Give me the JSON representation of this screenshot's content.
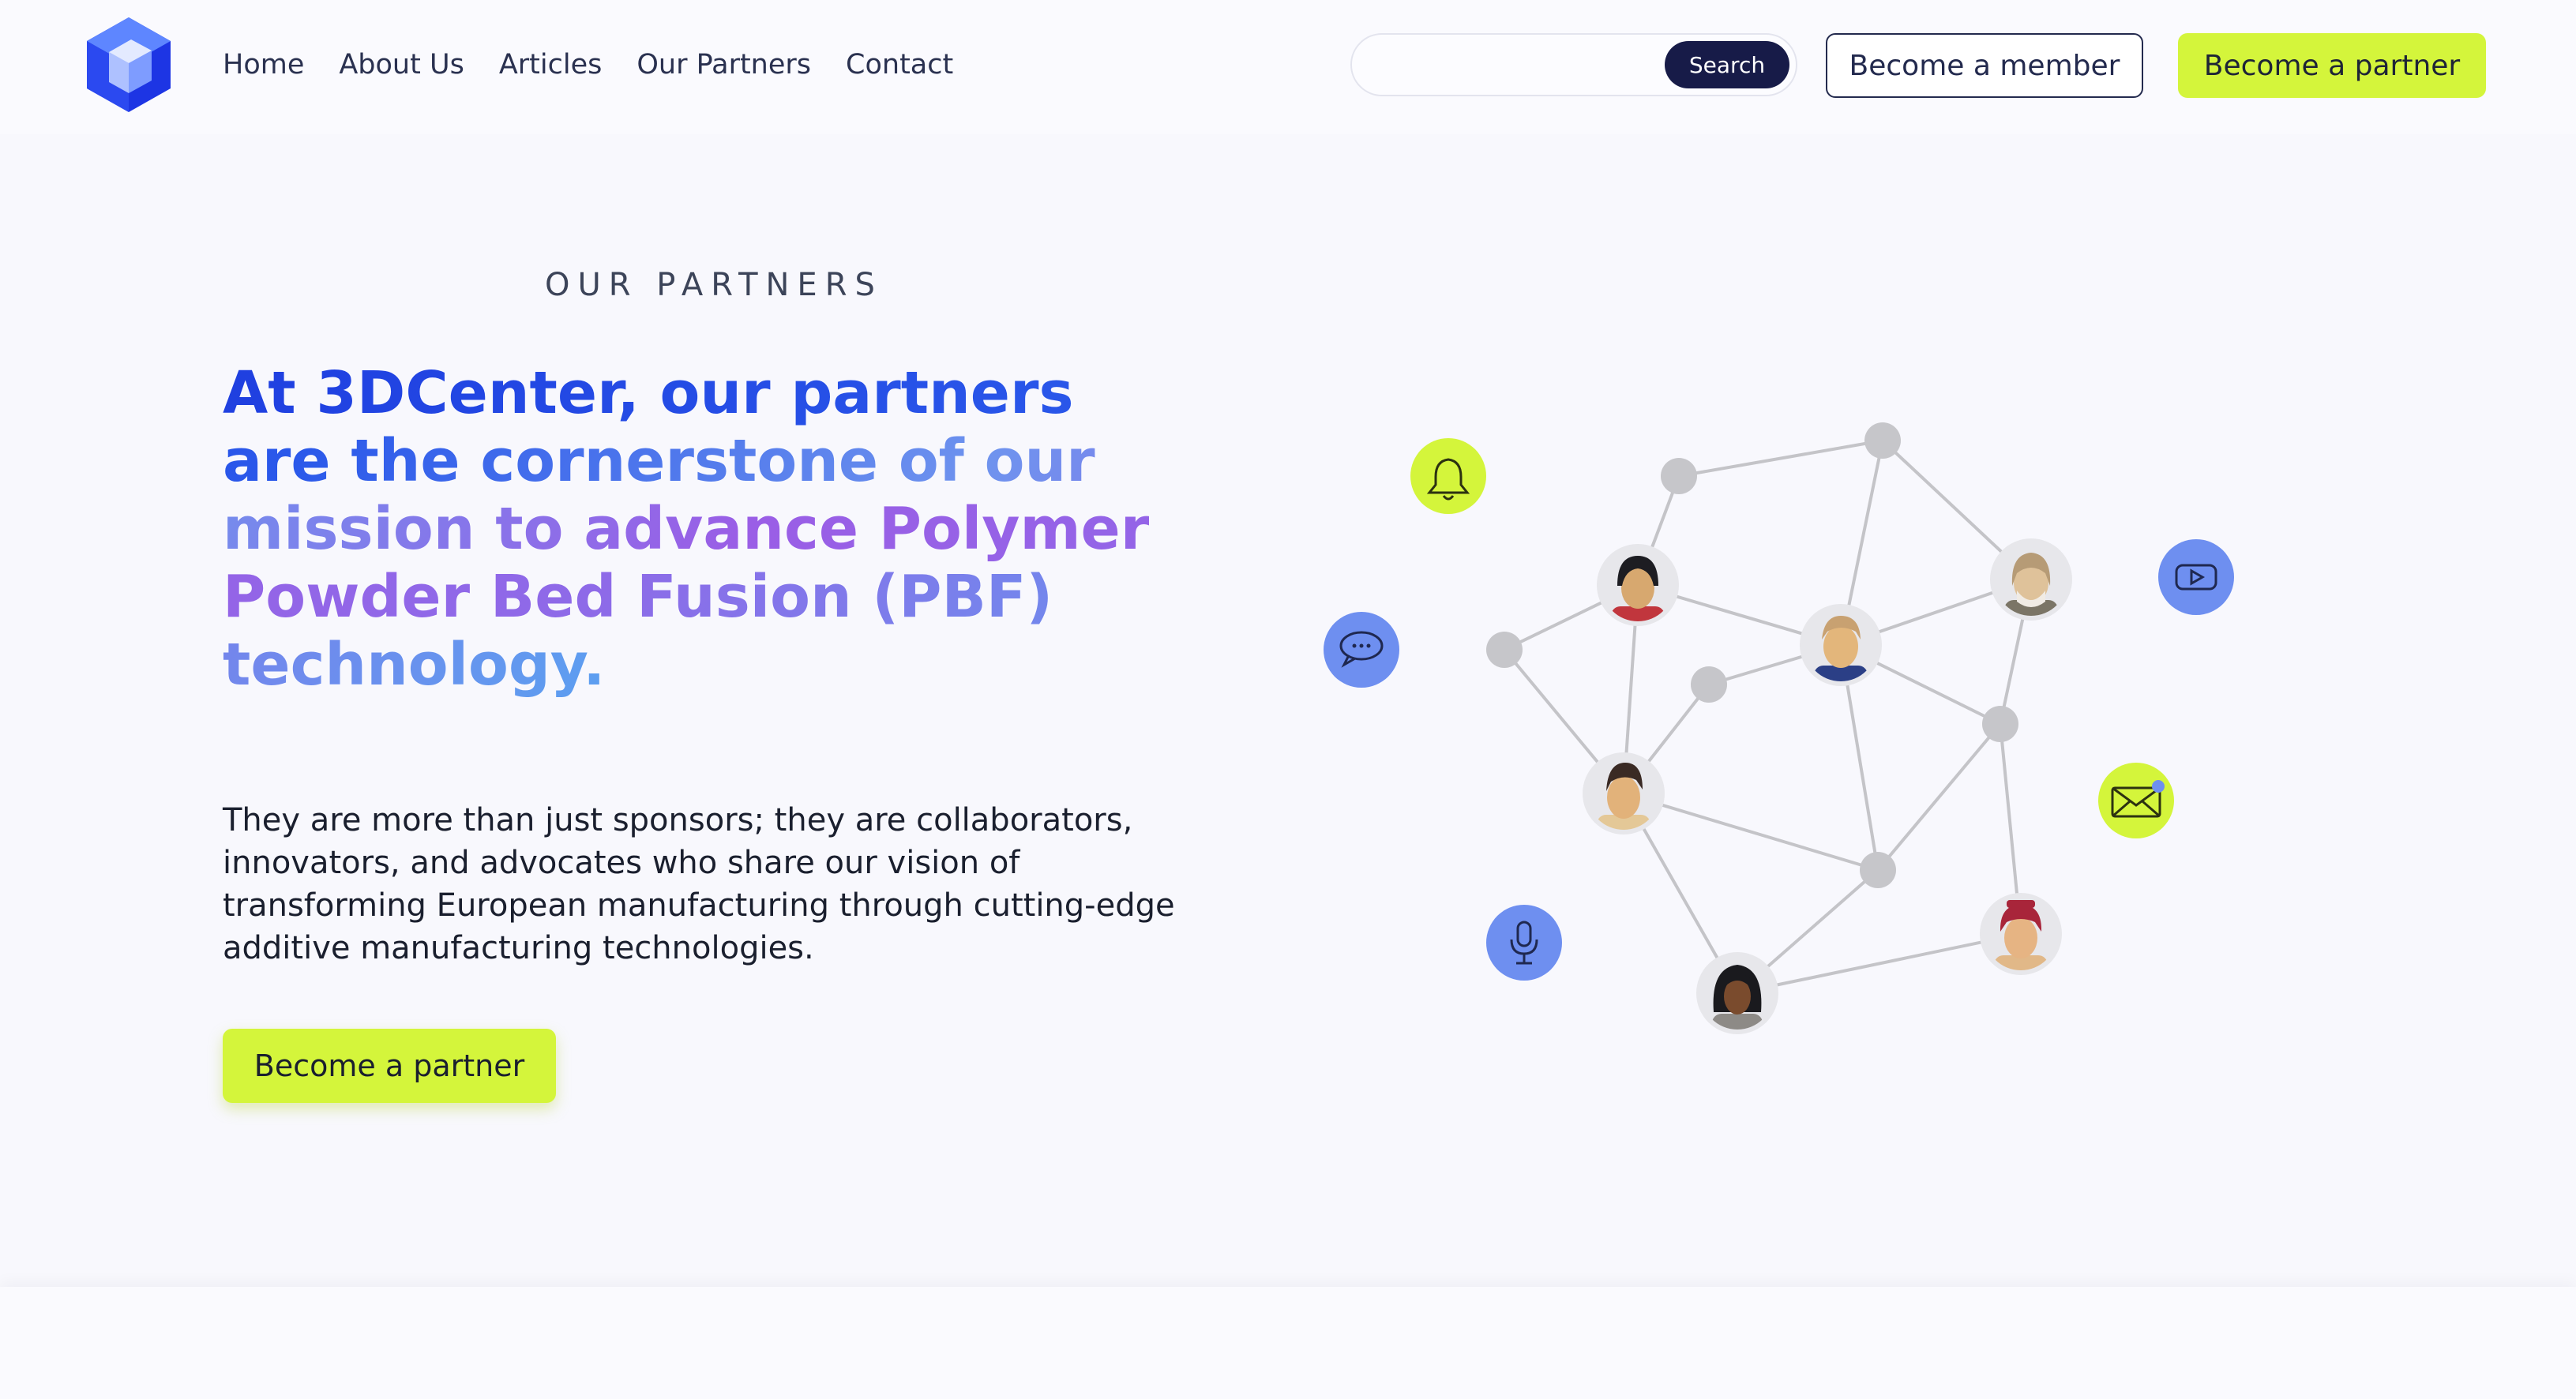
{
  "header": {
    "nav": [
      "Home",
      "About Us",
      "Articles",
      "Our Partners",
      "Contact"
    ],
    "search_placeholder": "",
    "search_button": "Search",
    "member_button": "Become a member",
    "partner_button": "Become a partner"
  },
  "hero": {
    "eyebrow": "OUR PARTNERS",
    "headline": "At 3DCenter, our partners are the cornerstone of our mission to advance Polymer Powder Bed Fusion (PBF) technology.",
    "body": "They are more than just sponsors; they are collaborators, innovators, and advocates who share our vision of transforming European manufacturing through cutting-edge additive manufacturing technologies.",
    "cta": "Become a partner"
  },
  "colors": {
    "accent": "#d4f53b",
    "navy": "#171b48",
    "brand_blue": "#1f3fe0",
    "icon_blue": "#6e8ff0"
  },
  "icons": [
    "bell-icon",
    "chat-icon",
    "youtube-icon",
    "mail-icon",
    "microphone-icon"
  ]
}
